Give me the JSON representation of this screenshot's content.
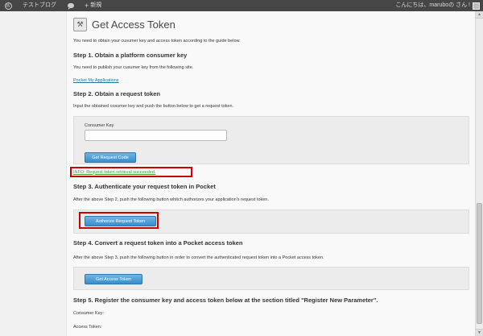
{
  "adminbar": {
    "site_name": "テストブログ",
    "new_label": "新規",
    "greeting": "こんにちは、maruboの さん !"
  },
  "page": {
    "title": "Get Access Token",
    "intro": "You need to obtain your cusumer key and access token according to the guide below.",
    "step1": {
      "heading": "Step 1.  Obtain a platform consumer key",
      "text": "You need to publish your cusumer key from the following site.",
      "link": "Pocket My Applications"
    },
    "step2": {
      "heading": "Step 2.  Obtain a request token",
      "text": "Input the obtained cosumer key and push the button below to get a request token.",
      "field_label": "Consumer Key",
      "field_value": "",
      "button": "Get Request Code",
      "info": "INFO: Request token retrieval succeeded."
    },
    "step3": {
      "heading": "Step 3.  Authenticate your request token in Pocket",
      "text": "After the above Step 2, push the following button whitch authorizes your application's request token.",
      "button": "Authorize Request Token"
    },
    "step4": {
      "heading": "Step 4.  Convert a request token into a Pocket access token",
      "text": "After the above Step 3, push the following button in order to convert the authenticated request token into a Pocket access token.",
      "button": "Get Access Token"
    },
    "step5": {
      "heading": "Step 5.  Register the consumer key and access token below at the section titled \"Register New Parameter\".",
      "consumer_key_label": "Consumer Key:",
      "access_token_label": "Access Token:"
    }
  },
  "colors": {
    "adminbar": "#464646",
    "button": "#3a8ccc",
    "highlight": "#cc0000",
    "info": "#3aa83a",
    "link": "#21759b"
  }
}
